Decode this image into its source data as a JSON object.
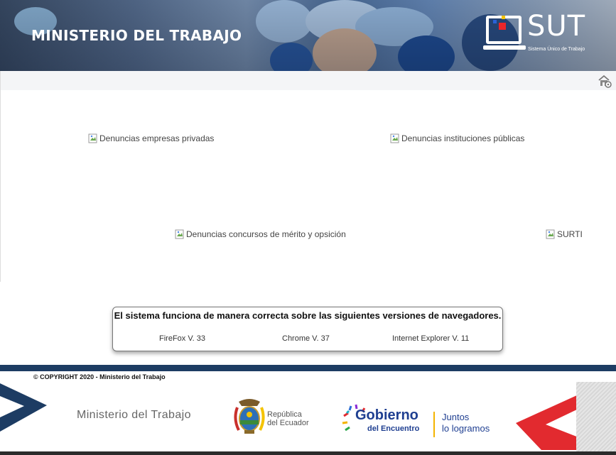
{
  "header": {
    "ministry_title": "MINISTERIO DEL TRABAJO",
    "logo_text": "SUT",
    "logo_subtitle": "Sistema Único de Trabajo"
  },
  "toolbar": {
    "home_icon": "home-settings-icon"
  },
  "content": {
    "links": [
      {
        "alt": "Denuncias empresas privadas"
      },
      {
        "alt": "Denuncias instituciones públicas"
      },
      {
        "alt": "Denuncias concursos de mérito y opsición"
      },
      {
        "alt": "SURTI"
      }
    ]
  },
  "browser_note": {
    "title": "El sistema funciona de manera correcta sobre las siguientes versiones de navegadores.",
    "versions": [
      "FireFox V. 33",
      "Chrome V. 37",
      "Internet Explorer V. 11"
    ]
  },
  "footer": {
    "copyright": "© COPYRIGHT 2020 - Ministerio del Trabajo",
    "ministerio": "Ministerio del Trabajo",
    "republica_line1": "República",
    "republica_line2": "del Ecuador",
    "gobierno": "Gobierno",
    "encuentro": "del Encuentro",
    "juntos_line1": "Juntos",
    "juntos_line2": "lo logramos"
  },
  "colors": {
    "navy_bar": "#1d3c63",
    "gobierno_blue": "#1f3f91",
    "accent_red": "#e22a2f"
  }
}
